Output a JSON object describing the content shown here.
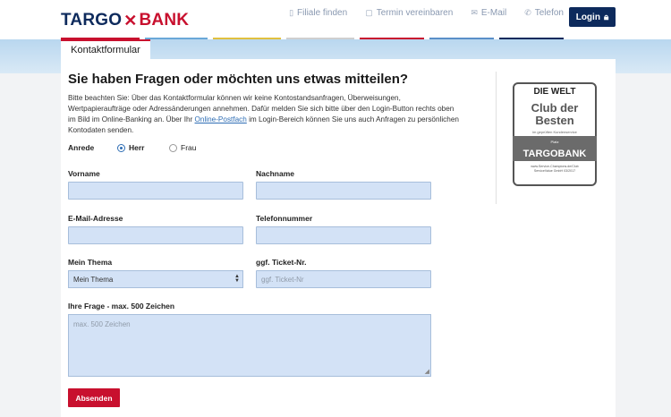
{
  "brand": {
    "targo": "TARGO",
    "bank": "BANK",
    "colors": {
      "navy": "#0d2a5c",
      "red": "#c8102e"
    }
  },
  "topnav": [
    {
      "label": "Filiale finden",
      "icon": "location-icon"
    },
    {
      "label": "Termin vereinbaren",
      "icon": "calendar-icon"
    },
    {
      "label": "E-Mail",
      "icon": "mail-icon"
    },
    {
      "label": "Telefon",
      "icon": "phone-icon"
    }
  ],
  "login": {
    "label": "Login",
    "icon": "lock-icon"
  },
  "tab": "Kontaktformular",
  "title": "Sie haben Fragen oder möchten uns etwas mitteilen?",
  "notice": {
    "part1": "Bitte beachten Sie: Über das Kontaktformular können wir keine Kontostandsanfragen, Überweisungen, Wertpapieraufträge oder Adressänderungen annehmen. Dafür melden Sie sich bitte über den Login-Button rechts oben im Bild im Online-Banking an. Über Ihr ",
    "link": "Online-Postfach",
    "part2": " im Login-Bereich können Sie uns auch Anfragen zu persönlichen Kontodaten senden."
  },
  "anrede": {
    "label": "Anrede",
    "options": [
      "Herr",
      "Frau"
    ],
    "selected": "Herr"
  },
  "fields": {
    "vorname": {
      "label": "Vorname",
      "value": ""
    },
    "nachname": {
      "label": "Nachname",
      "value": ""
    },
    "email": {
      "label": "E-Mail-Adresse",
      "value": ""
    },
    "telefon": {
      "label": "Telefonnummer",
      "value": ""
    },
    "thema": {
      "label": "Mein Thema",
      "value": "Mein Thema"
    },
    "ticket": {
      "label": "ggf. Ticket-Nr.",
      "placeholder": "ggf. Ticket-Nr"
    },
    "frage": {
      "label": "Ihre Frage - max. 500 Zeichen",
      "placeholder": "max. 500 Zeichen"
    }
  },
  "submit": "Absenden",
  "badge": {
    "die_welt": "DIE WELT",
    "club": "Club der",
    "besten": "Besten",
    "sub": "im geprüften Kundenservice",
    "platz": "Platz",
    "brand": "TARGOBANK",
    "foot1": "www.Service-Champions.de/Club",
    "foot2": "ServiceValue GmbH",
    "year": "03/2017"
  }
}
